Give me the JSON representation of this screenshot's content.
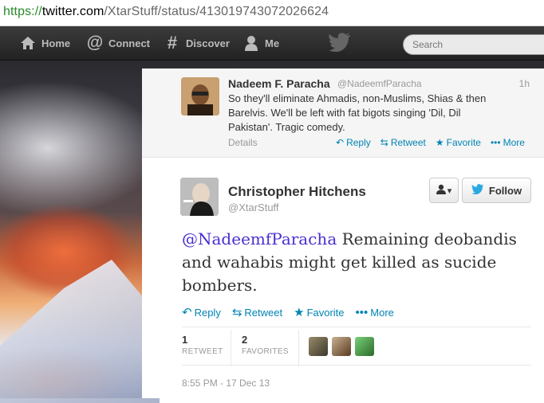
{
  "browser": {
    "url_scheme": "https://",
    "url_domain": "twitter.com",
    "url_path": "/XtarStuff/status/413019743072026624"
  },
  "nav": {
    "home": "Home",
    "connect": "Connect",
    "discover": "Discover",
    "me": "Me",
    "search_placeholder": "Search"
  },
  "previous_tweet": {
    "name": "Nadeem F. Paracha",
    "handle": "@NadeemfParacha",
    "time": "1h",
    "text": "So they'll eliminate Ahmadis, non-Muslims, Shias & then Barelvis. We'll be left with fat bigots singing 'Dil, Dil Pakistan'. Tragic comedy.",
    "details_label": "Details",
    "actions": {
      "reply": "Reply",
      "retweet": "Retweet",
      "favorite": "Favorite",
      "more": "More"
    }
  },
  "tweet": {
    "name": "Christopher Hitchens",
    "handle": "@XtarStuff",
    "follow_label": "Follow",
    "mention": "@NadeemfParacha",
    "text": " Remaining deobandis and wahabis might get killed as sucide bombers.",
    "actions": {
      "reply": "Reply",
      "retweet": "Retweet",
      "favorite": "Favorite",
      "more": "More"
    },
    "retweets": {
      "count": "1",
      "label": "RETWEET"
    },
    "favorites": {
      "count": "2",
      "label": "FAVORITES"
    },
    "timestamp": "8:55 PM - 17 Dec 13"
  },
  "colors": {
    "link": "#0084b4",
    "mention": "#4a2fd0"
  }
}
